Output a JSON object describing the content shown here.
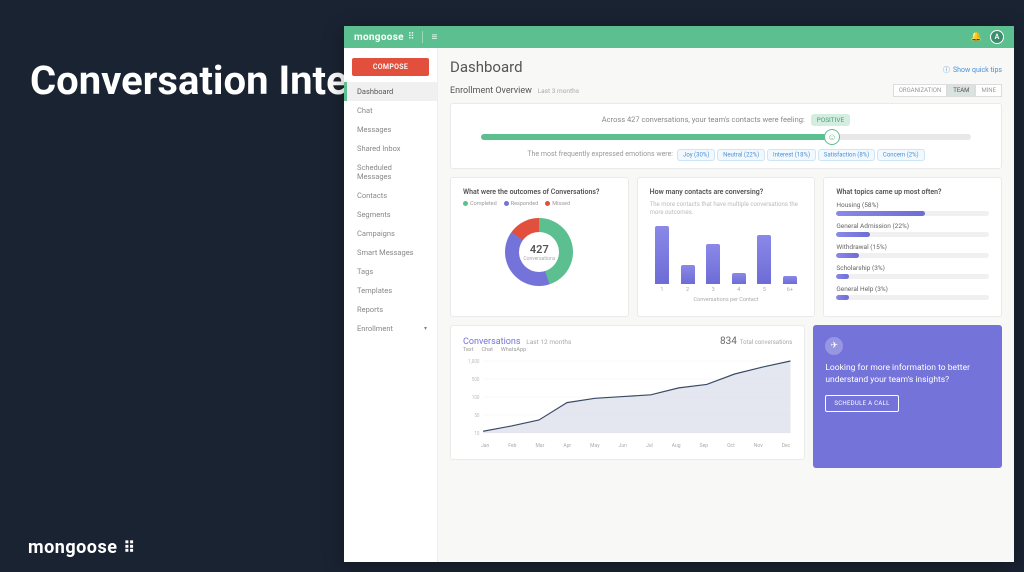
{
  "slide": {
    "title": "Conversation Intelligence in Action",
    "brand": "mongoose"
  },
  "topbar": {
    "brand": "mongoose",
    "avatar_initial": "A"
  },
  "sidebar": {
    "compose_label": "COMPOSE",
    "items": [
      {
        "label": "Dashboard",
        "active": true
      },
      {
        "label": "Chat"
      },
      {
        "label": "Messages"
      },
      {
        "label": "Shared Inbox"
      },
      {
        "label": "Scheduled Messages"
      },
      {
        "label": "Contacts"
      },
      {
        "label": "Segments"
      },
      {
        "label": "Campaigns"
      },
      {
        "label": "Smart Messages"
      },
      {
        "label": "Tags"
      },
      {
        "label": "Templates"
      },
      {
        "label": "Reports"
      },
      {
        "label": "Enrollment",
        "parent": true
      }
    ]
  },
  "dashboard": {
    "title": "Dashboard",
    "quick_tips": "Show quick tips",
    "enrollment_title": "Enrollment Overview",
    "enrollment_period": "Last 3 months",
    "view_options": [
      "ORGANIZATION",
      "TEAM",
      "MINE"
    ],
    "view_active": "TEAM"
  },
  "sentiment": {
    "intro_prefix": "Across ",
    "count": "427",
    "intro_suffix": " conversations, your team's contacts were feeling:",
    "feeling_pill": "POSITIVE",
    "bar_percent": 72,
    "emotions_label": "The most frequently expressed emotions were:",
    "emotions": [
      {
        "label": "Joy (30%)"
      },
      {
        "label": "Neutral (22%)"
      },
      {
        "label": "Interest (18%)"
      },
      {
        "label": "Satisfaction (8%)"
      },
      {
        "label": "Concern (2%)"
      }
    ]
  },
  "outcomes": {
    "title": "What were the outcomes of Conversations?",
    "legend": [
      {
        "label": "Completed",
        "color": "#5cbf8f"
      },
      {
        "label": "Responded",
        "color": "#7473d9"
      },
      {
        "label": "Missed",
        "color": "#e24f3d"
      }
    ],
    "center_number": "427",
    "center_label": "Conversations",
    "chart_data": {
      "type": "pie",
      "series": [
        {
          "name": "Completed",
          "value": 45
        },
        {
          "name": "Responded",
          "value": 40
        },
        {
          "name": "Missed",
          "value": 15
        }
      ]
    }
  },
  "contacts_conversing": {
    "title": "How many contacts are conversing?",
    "subtitle": "The more contacts that have multiple conversations the more outcomes.",
    "axis_label": "Conversations per Contact",
    "chart_data": {
      "type": "bar",
      "categories": [
        "1",
        "2",
        "3",
        "4",
        "5",
        "6+"
      ],
      "values": [
        95,
        30,
        65,
        18,
        80,
        12
      ]
    }
  },
  "topics": {
    "title": "What topics came up most often?",
    "items": [
      {
        "label": "Housing (58%)",
        "pct": 58
      },
      {
        "label": "General Admission (22%)",
        "pct": 22
      },
      {
        "label": "Withdrawal (15%)",
        "pct": 15
      },
      {
        "label": "Scholarship (3%)",
        "pct": 8
      },
      {
        "label": "General Help (3%)",
        "pct": 8
      }
    ]
  },
  "conversations": {
    "title": "Conversations",
    "period": "Last 12 months",
    "total_number": "834",
    "total_label": "Total conversations",
    "legend": [
      {
        "label": "Text",
        "color": "#3a4a66"
      },
      {
        "label": "Chat",
        "color": "#b6b5e8"
      },
      {
        "label": "WhatsApp",
        "color": "#d4ede1"
      }
    ],
    "y_ticks": [
      "1,000",
      "500",
      "100",
      "50",
      "10"
    ],
    "chart_data": {
      "type": "area",
      "x": [
        "Jan",
        "Feb",
        "Mar",
        "Apr",
        "May",
        "Jun",
        "Jul",
        "Aug",
        "Sep",
        "Oct",
        "Nov",
        "Dec"
      ],
      "values": [
        20,
        80,
        150,
        350,
        400,
        420,
        440,
        520,
        560,
        680,
        760,
        830
      ]
    }
  },
  "cta": {
    "text": "Looking for more information to better understand your team's insights?",
    "button": "SCHEDULE A CALL"
  }
}
